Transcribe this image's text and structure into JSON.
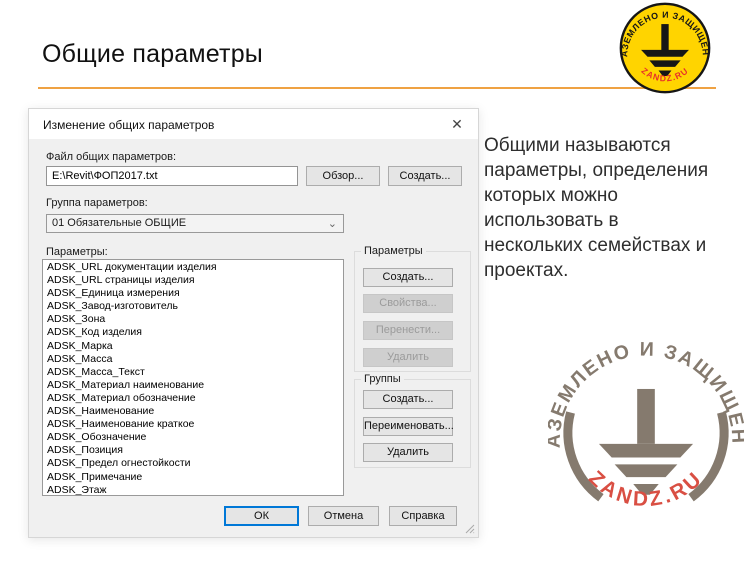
{
  "slide": {
    "title": "Общие параметры",
    "accent_color": "#EFA243",
    "description": "Общими называются параметры, определения которых можно использовать в нескольких семействах и проектах."
  },
  "logo": {
    "arc_text": "ЗАЗЕМЛЕНО И ЗАЩИЩЕНО",
    "site_text": "ZANDZ.RU",
    "yellow": "#FFD400",
    "black": "#161616",
    "red": "#E8312A",
    "watermark_gray": "#857A6E",
    "watermark_red": "#D94F43"
  },
  "dialog": {
    "title": "Изменение общих параметров",
    "close_glyph": "✕",
    "file_section": {
      "label": "Файл общих параметров:",
      "value": "E:\\Revit\\ФОП2017.txt",
      "browse_label": "Обзор...",
      "create_label": "Создать..."
    },
    "group_section": {
      "label": "Группа параметров:",
      "selected_option": "01 Обязательные ОБЩИЕ",
      "chevron_glyph": "⌄"
    },
    "params_label": "Параметры:",
    "parameters": [
      "ADSK_URL документации изделия",
      "ADSK_URL страницы изделия",
      "ADSK_Единица измерения",
      "ADSK_Завод-изготовитель",
      "ADSK_Зона",
      "ADSK_Код изделия",
      "ADSK_Марка",
      "ADSK_Масса",
      "ADSK_Масса_Текст",
      "ADSK_Материал наименование",
      "ADSK_Материал обозначение",
      "ADSK_Наименование",
      "ADSK_Наименование краткое",
      "ADSK_Обозначение",
      "ADSK_Позиция",
      "ADSK_Предел огнестойкости",
      "ADSK_Примечание",
      "ADSK_Этаж"
    ],
    "params_group": {
      "title": "Параметры",
      "buttons": [
        {
          "label": "Создать...",
          "enabled": true
        },
        {
          "label": "Свойства...",
          "enabled": false
        },
        {
          "label": "Перенести...",
          "enabled": false
        },
        {
          "label": "Удалить",
          "enabled": false
        }
      ]
    },
    "groups_group": {
      "title": "Группы",
      "buttons": [
        {
          "label": "Создать...",
          "enabled": true
        },
        {
          "label": "Переименовать...",
          "enabled": true
        },
        {
          "label": "Удалить",
          "enabled": true
        }
      ]
    },
    "footer": {
      "ok_label": "ОК",
      "cancel_label": "Отмена",
      "help_label": "Справка"
    },
    "focus_color": "#0078D7"
  }
}
